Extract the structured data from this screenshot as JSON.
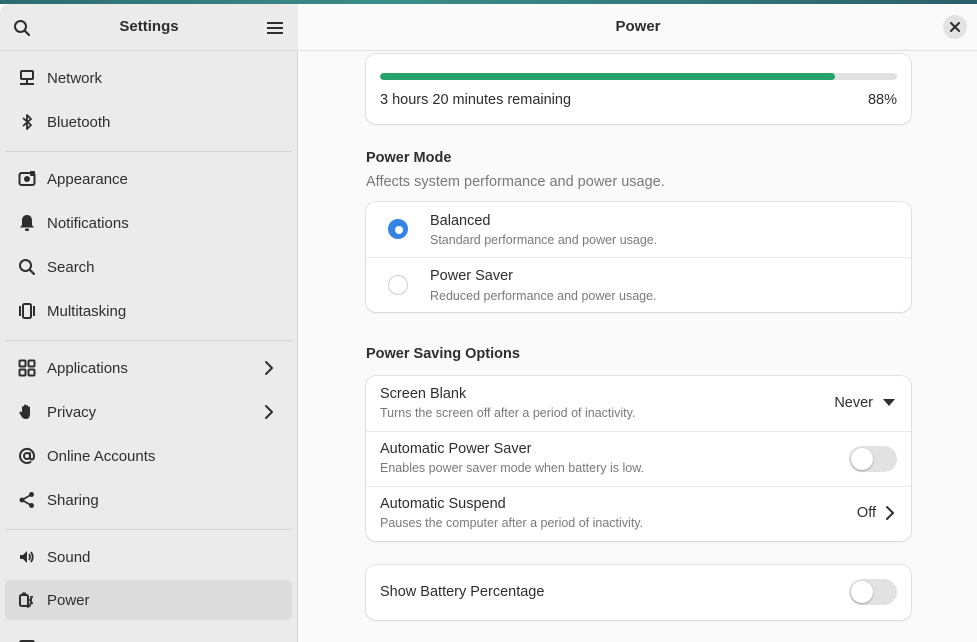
{
  "app": {
    "sidebar_title": "Settings",
    "page_title": "Power"
  },
  "icons": {
    "search": "search-icon",
    "menu": "hamburger-menu-icon",
    "close": "close-icon"
  },
  "sidebar": {
    "items": [
      {
        "label": "Network",
        "icon": "network-icon"
      },
      {
        "label": "Bluetooth",
        "icon": "bluetooth-icon"
      },
      {
        "label": "Appearance",
        "icon": "appearance-icon"
      },
      {
        "label": "Notifications",
        "icon": "bell-icon"
      },
      {
        "label": "Search",
        "icon": "search-icon"
      },
      {
        "label": "Multitasking",
        "icon": "multitasking-icon"
      },
      {
        "label": "Applications",
        "icon": "grid-icon"
      },
      {
        "label": "Privacy",
        "icon": "hand-icon"
      },
      {
        "label": "Online Accounts",
        "icon": "at-icon"
      },
      {
        "label": "Sharing",
        "icon": "share-icon"
      },
      {
        "label": "Sound",
        "icon": "speaker-icon"
      },
      {
        "label": "Power",
        "icon": "power-plug-icon"
      }
    ],
    "active": "Power"
  },
  "battery": {
    "remaining": "3 hours 20 minutes remaining",
    "percent_label": "88%",
    "level": 0.88,
    "bar_color": "#26a269"
  },
  "power_mode": {
    "title": "Power Mode",
    "subtitle": "Affects system performance and power usage.",
    "options": [
      {
        "title": "Balanced",
        "subtitle": "Standard performance and power usage.",
        "selected": true
      },
      {
        "title": "Power Saver",
        "subtitle": "Reduced performance and power usage.",
        "selected": false
      }
    ]
  },
  "power_saving": {
    "title": "Power Saving Options",
    "screen_blank": {
      "title": "Screen Blank",
      "subtitle": "Turns the screen off after a period of inactivity.",
      "value": "Never"
    },
    "auto_power_saver": {
      "title": "Automatic Power Saver",
      "subtitle": "Enables power saver mode when battery is low.",
      "enabled": false
    },
    "auto_suspend": {
      "title": "Automatic Suspend",
      "subtitle": "Pauses the computer after a period of inactivity.",
      "value": "Off"
    }
  },
  "battery_percentage": {
    "title": "Show Battery Percentage",
    "enabled": false
  },
  "colors": {
    "accent": "#3584e4",
    "sidebar_bg": "#ebebeb",
    "active_item_bg": "#dcdcdc"
  }
}
